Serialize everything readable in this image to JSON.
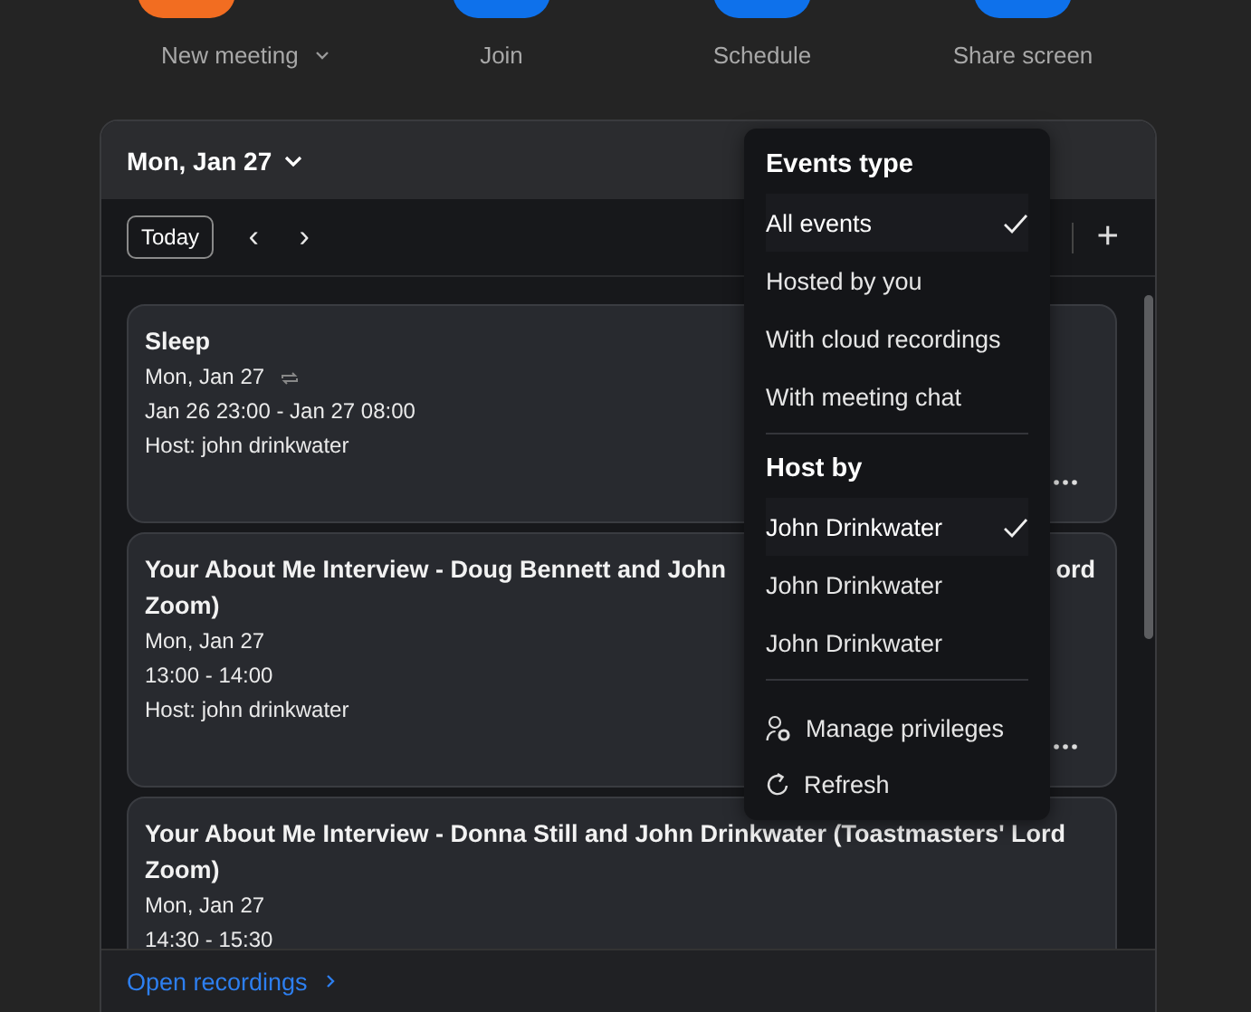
{
  "top_actions": [
    {
      "label": "New meeting",
      "color": "#f26d21",
      "has_dropdown": true
    },
    {
      "label": "Join",
      "color": "#0e71eb",
      "has_dropdown": false
    },
    {
      "label": "Schedule",
      "color": "#0e71eb",
      "has_dropdown": false
    },
    {
      "label": "Share screen",
      "color": "#0e71eb",
      "has_dropdown": false
    }
  ],
  "calendar": {
    "date": "Mon, Jan 27",
    "today": "Today",
    "prev": "‹",
    "next": "›",
    "add": "+"
  },
  "events": [
    {
      "title": "Sleep",
      "date": "Mon, Jan 27",
      "recurring": true,
      "time": "Jan 26 23:00 - Jan 27 08:00",
      "host": "Host: john drinkwater"
    },
    {
      "title": "Your About Me Interview - Doug Bennett and John",
      "title_tail": "ord",
      "title_line2": "Zoom)",
      "date": "Mon, Jan 27",
      "recurring": false,
      "time": "13:00 - 14:00",
      "host": "Host: john drinkwater"
    },
    {
      "title": "Your About Me Interview - Donna Still and John Drinkwater (Toastmasters' Lord",
      "title_line2": "Zoom)",
      "date": "Mon, Jan 27",
      "recurring": false,
      "time": "14:30 - 15:30"
    }
  ],
  "footer": {
    "link": "Open recordings"
  },
  "menu": {
    "sections": [
      {
        "heading": "Events type",
        "items": [
          {
            "label": "All events",
            "selected": true
          },
          {
            "label": "Hosted by you",
            "selected": false
          },
          {
            "label": "With cloud recordings",
            "selected": false
          },
          {
            "label": "With meeting chat",
            "selected": false
          }
        ]
      },
      {
        "heading": "Host by",
        "items": [
          {
            "label": "John Drinkwater",
            "selected": true
          },
          {
            "label": "John Drinkwater",
            "selected": false
          },
          {
            "label": "John Drinkwater",
            "selected": false
          }
        ]
      }
    ],
    "actions": [
      {
        "label": "Manage privileges",
        "kind": "privileges"
      },
      {
        "label": "Refresh",
        "kind": "refresh"
      }
    ]
  }
}
